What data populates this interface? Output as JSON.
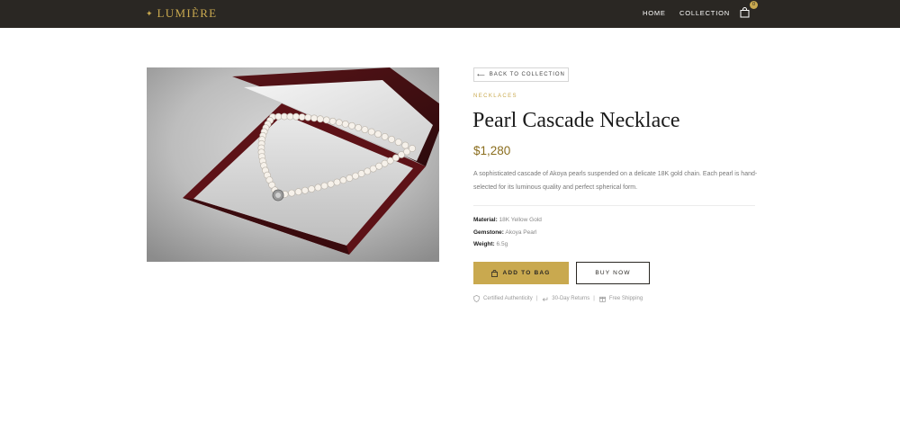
{
  "header": {
    "brand_star": "✦",
    "brand_name": "LUMIÈRE",
    "nav": {
      "home": "HOME",
      "collection": "COLLECTION"
    },
    "cart_count": "0",
    "cart_icon": "shopping-bag-icon"
  },
  "product": {
    "image_alt": "Pearl necklace in an open red box",
    "back_arrow": "⟵",
    "back_label": "BACK TO COLLECTION",
    "category": "NECKLACES",
    "title": "Pearl Cascade Necklace",
    "price": "$1,280",
    "description": "A sophisticated cascade of Akoya pearls suspended on a delicate 18K gold chain. Each pearl is hand-selected for its luminous quality and perfect spherical form.",
    "specs": [
      {
        "label": "Material:",
        "value": "18K Yellow Gold"
      },
      {
        "label": "Gemstone:",
        "value": "Akoya Pearl"
      },
      {
        "label": "Weight:",
        "value": "6.5g"
      }
    ],
    "add_to_bag": "ADD TO BAG",
    "buy_now": "BUY NOW",
    "perks": [
      {
        "icon": "shield-icon",
        "label": "Certified Authenticity"
      },
      {
        "icon": "return-arrow-icon",
        "label": "30-Day Returns"
      },
      {
        "icon": "gift-box-icon",
        "label": "Free Shipping"
      }
    ],
    "perk_separator": "|"
  },
  "colors": {
    "header_bg": "#2a2723",
    "accent_gold": "#c9a94f",
    "price_gold": "#8a6d1d"
  }
}
